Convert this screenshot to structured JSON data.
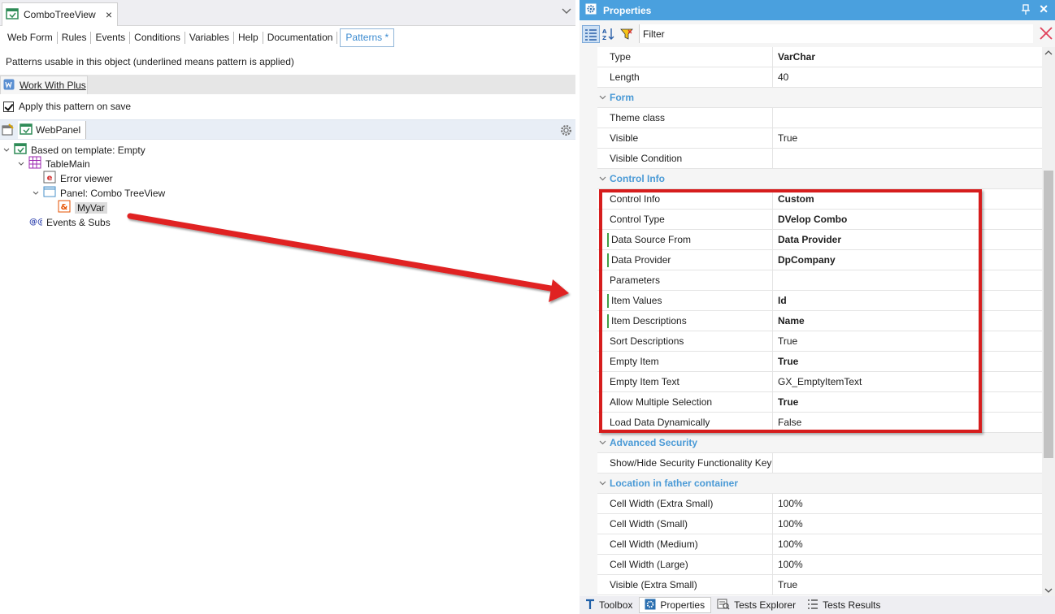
{
  "document_tab": {
    "title": "ComboTreeView",
    "close_glyph": "×",
    "icon": "webpanel-icon"
  },
  "subtabs": [
    "Web Form",
    "Rules",
    "Events",
    "Conditions",
    "Variables",
    "Help",
    "Documentation",
    "Patterns *"
  ],
  "hint_text": "Patterns usable in this object (underlined means pattern is applied)",
  "pattern_tab": {
    "label": "Work With Plus",
    "icon": "workwith-icon"
  },
  "apply_pattern": {
    "label": "Apply this pattern on save",
    "checked": true
  },
  "tree_toolbar": {
    "node_label": "WebPanel"
  },
  "tree": [
    {
      "label": "Based on template: Empty",
      "icon": "webpanel-icon",
      "expanded": true
    },
    {
      "label": "TableMain",
      "icon": "table-icon",
      "expanded": true
    },
    {
      "label": "Error viewer",
      "icon": "error-viewer-icon"
    },
    {
      "label": "Panel: Combo TreeView",
      "icon": "panel-icon",
      "expanded": true
    },
    {
      "label": "MyVar",
      "icon": "variable-icon",
      "selected": true
    },
    {
      "label": "Events & Subs",
      "icon": "events-icon"
    }
  ],
  "properties_panel": {
    "title": "Properties",
    "filter_label": "Filter",
    "rows": [
      {
        "kind": "prop",
        "name": "Type",
        "value": "VarChar",
        "bold": true
      },
      {
        "kind": "prop",
        "name": "Length",
        "value": "40"
      },
      {
        "kind": "cat",
        "name": "Form"
      },
      {
        "kind": "prop",
        "name": "Theme class",
        "value": ""
      },
      {
        "kind": "prop",
        "name": "Visible",
        "value": "True"
      },
      {
        "kind": "prop",
        "name": "Visible Condition",
        "value": ""
      },
      {
        "kind": "cat",
        "name": "Control Info"
      },
      {
        "kind": "prop",
        "name": "Control Info",
        "value": "Custom",
        "bold": true
      },
      {
        "kind": "prop",
        "name": "Control Type",
        "value": "DVelop Combo",
        "bold": true
      },
      {
        "kind": "prop",
        "name": "Data Source From",
        "value": "Data Provider",
        "bold": true,
        "marked": true
      },
      {
        "kind": "prop",
        "name": "Data Provider",
        "value": "DpCompany",
        "bold": true,
        "marked": true
      },
      {
        "kind": "prop",
        "name": "Parameters",
        "value": ""
      },
      {
        "kind": "prop",
        "name": "Item Values",
        "value": "Id",
        "bold": true,
        "marked": true
      },
      {
        "kind": "prop",
        "name": "Item Descriptions",
        "value": "Name",
        "bold": true,
        "marked": true
      },
      {
        "kind": "prop",
        "name": "Sort Descriptions",
        "value": "True"
      },
      {
        "kind": "prop",
        "name": "Empty Item",
        "value": "True",
        "bold": true
      },
      {
        "kind": "prop",
        "name": "Empty Item Text",
        "value": "GX_EmptyItemText"
      },
      {
        "kind": "prop",
        "name": "Allow Multiple Selection",
        "value": "True",
        "bold": true
      },
      {
        "kind": "prop",
        "name": "Load Data Dynamically",
        "value": "False"
      },
      {
        "kind": "cat",
        "name": "Advanced Security"
      },
      {
        "kind": "prop",
        "name": "Show/Hide Security Functionality Key",
        "value": ""
      },
      {
        "kind": "cat",
        "name": "Location in father container"
      },
      {
        "kind": "prop",
        "name": "Cell Width (Extra Small)",
        "value": "100%"
      },
      {
        "kind": "prop",
        "name": "Cell Width (Small)",
        "value": "100%"
      },
      {
        "kind": "prop",
        "name": "Cell Width (Medium)",
        "value": "100%"
      },
      {
        "kind": "prop",
        "name": "Cell Width (Large)",
        "value": "100%"
      },
      {
        "kind": "prop",
        "name": "Visible (Extra Small)",
        "value": "True"
      }
    ]
  },
  "bottom_tabs": [
    {
      "label": "Toolbox",
      "icon": "toolbox-icon"
    },
    {
      "label": "Properties",
      "icon": "gear-icon",
      "active": true
    },
    {
      "label": "Tests Explorer",
      "icon": "tests-explorer-icon"
    },
    {
      "label": "Tests Results",
      "icon": "tests-results-icon"
    }
  ],
  "colors": {
    "accent": "#4aa0de",
    "highlight": "#d61d1d",
    "category": "#4a9ad6",
    "modified_marker": "#43a047"
  }
}
